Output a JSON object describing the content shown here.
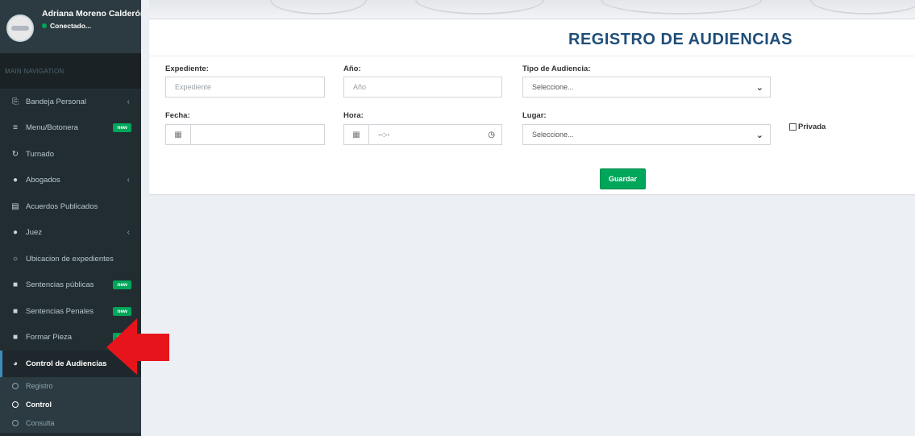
{
  "user": {
    "name": "Adriana Moreno Calderón",
    "status": "Conectado..."
  },
  "sidebar": {
    "header": "MAIN NAVIGATION",
    "items": [
      {
        "label": "Bandeja Personal",
        "icon": "inbox-icon",
        "caret": "‹"
      },
      {
        "label": "Menu/Botonera",
        "icon": "bars-icon",
        "badge": "new"
      },
      {
        "label": "Turnado",
        "icon": "refresh-icon"
      },
      {
        "label": "Abogados",
        "icon": "users-icon",
        "caret": "‹"
      },
      {
        "label": "Acuerdos Publicados",
        "icon": "document-icon"
      },
      {
        "label": "Juez",
        "icon": "users-icon",
        "caret": "‹"
      },
      {
        "label": "Ubicacion de expedientes",
        "icon": "circle-icon"
      },
      {
        "label": "Sentencias públicas",
        "icon": "folder-icon",
        "badge": "new"
      },
      {
        "label": "Sentencias Penales",
        "icon": "folder-icon",
        "badge": "new"
      },
      {
        "label": "Formar Pieza",
        "icon": "folder-icon",
        "badge": "new"
      },
      {
        "label": "Control de Audiencias",
        "icon": "dashboard-icon"
      }
    ],
    "submenu": [
      {
        "label": "Registro"
      },
      {
        "label": "Control"
      },
      {
        "label": "Consulta"
      }
    ]
  },
  "form": {
    "title": "REGISTRO DE AUDIENCIAS",
    "expediente": {
      "label": "Expediente:",
      "placeholder": "Expediente"
    },
    "anio": {
      "label": "Año:",
      "placeholder": "Año"
    },
    "tipo": {
      "label": "Tipo de Audiencia:",
      "value": "Seleccione..."
    },
    "fecha": {
      "label": "Fecha:",
      "value": ""
    },
    "hora": {
      "label": "Hora:",
      "value": "--:--"
    },
    "lugar": {
      "label": "Lugar:",
      "value": "Seleccione..."
    },
    "privada": {
      "label": "Privada",
      "checked": false
    },
    "save_label": "Guardar"
  },
  "colors": {
    "sidebar_bg": "#222d32",
    "accent_green": "#00a65a",
    "title_blue": "#1f4e79",
    "annotation_red": "#e8141c"
  }
}
